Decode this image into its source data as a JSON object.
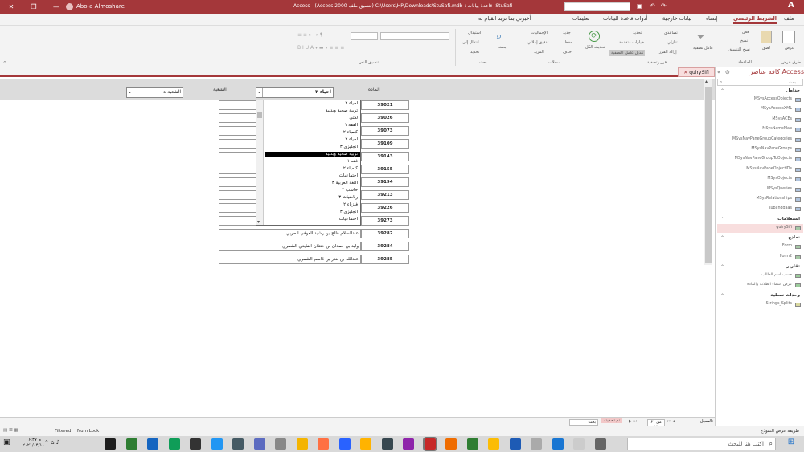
{
  "titlebar": {
    "user": "Abo-a Almoshare",
    "title": "Access  -  (Access 2000 تنسيق ملف) C:\\Users\\HP\\Downloads\\StuSafi.mdb : قاعدة بيانات- StuSafi"
  },
  "ribbon_tabs": [
    "ملف",
    "الشريط الرئيسي",
    "إنشاء",
    "بيانات خارجية",
    "أدوات قاعدة البيانات",
    "تعليمات",
    "أخبرني بما تريد القيام به"
  ],
  "ribbon": {
    "views_btn": "عرض",
    "views_group": "طرق عرض",
    "paste": "لصق",
    "cut": "قص",
    "copy": "نسخ",
    "format_painter": "نسخ التنسيق",
    "clipboard_group": "الحافظة",
    "filter": "عامل تصفية",
    "ascending": "تصاعدي",
    "descending": "تنازلي",
    "remove_sort": "إزالة الفرز",
    "selection": "تحديد",
    "advanced": "خيارات متقدمة",
    "toggle_filter": "تبديل عامل التصفية",
    "sort_filter_group": "فرز وتصفية",
    "refresh_all": "تحديث الكل",
    "new": "جديد",
    "save": "حفظ",
    "delete": "حذف",
    "totals": "الإجماليات",
    "spelling": "تدقيق إملائي",
    "more": "المزيد",
    "records_group": "سجلات",
    "find": "بحث",
    "replace": "استبدال",
    "goto": "انتقال إلى",
    "select": "تحديد",
    "find_group": "بحث",
    "text_format_group": "تنسيق النص"
  },
  "navpane": {
    "header": "كافة عناصر Access",
    "search_placeholder": "بحث...",
    "sections": [
      {
        "title": "جداول",
        "items": [
          "MSysAccessObjects",
          "MSysAccessXML",
          "MSysACEs",
          "MSysNameMap",
          "MSysNavPaneGroupCategories",
          "MSysNavPaneGroups",
          "MSysNavPaneGroupToObjects",
          "MSysNavPaneObjectIDs",
          "MSysObjects",
          "MSysQueries",
          "MSysRelationships",
          "subanddaas"
        ]
      },
      {
        "title": "استعلامات",
        "items": [
          "quirySifi"
        ]
      },
      {
        "title": "نماذج",
        "items": [
          "Form",
          "Form2"
        ]
      },
      {
        "title": "تقارير",
        "items": [
          "حسب اسم الطالب",
          "عرض أسماء الطلاب والمادة"
        ]
      },
      {
        "title": "وحدات نمطية",
        "items": [
          "Strings_Splits"
        ]
      }
    ]
  },
  "doc_tab": "quirySifi",
  "form": {
    "header_subject": "المادة",
    "header_section": "الشعبة",
    "subject_combo_value": "احياء ۲",
    "section_combo_value": "الشعبة ه",
    "records": [
      {
        "id": "39021",
        "name": "جهاد بن عب"
      },
      {
        "id": "39026",
        "name": "تركي بن فهد"
      },
      {
        "id": "39073",
        "name": "سعود بن عبد"
      },
      {
        "id": "39109",
        "name": "عبدالعزيز بن"
      },
      {
        "id": "39143",
        "name": "عبيد بن ناصر"
      },
      {
        "id": "39155",
        "name": "يوسف عادل"
      },
      {
        "id": "39194",
        "name": "مهند بن حسين"
      },
      {
        "id": "39213",
        "name": "محمد بن خالد"
      },
      {
        "id": "39226",
        "name": "محمد بن مريع"
      },
      {
        "id": "39273",
        "name": "حسين علي"
      },
      {
        "id": "39282",
        "name": "عبدالسلام فالح بن رشيد العوفي الحربي"
      },
      {
        "id": "39284",
        "name": "وليد بن حمدان بن خنتلان الفايدي الشمري"
      },
      {
        "id": "39285",
        "name": "عبدالله بن بندر بن قاسم الشمري"
      }
    ]
  },
  "dropdown_items": [
    "احياء ۲",
    "تربية صحية وبدنية",
    "لغتي",
    "الفقه ۱",
    "كيمياء ۲",
    "احياء ۲",
    "انجليزي ۳",
    "تربية صحية وبدنية",
    "فقه ۱",
    "كيمياء ۲",
    "اجتماعيات",
    "اللغة العربية ۳",
    "حاسب ۲",
    "رياضيات ۳",
    "فيزياء ۲",
    "انجليزي ۳",
    "اجتماعيات"
  ],
  "dropdown_selected_index": 7,
  "record_nav": {
    "label": "السجل:",
    "position": "۶۱ من ۱۳",
    "filtered": "تم تصفيته",
    "search": "بحث"
  },
  "statusbar": {
    "view_text": "طريقة عرض النموذج",
    "filtered": "Filtered",
    "numlock": "Num Lock"
  },
  "taskbar": {
    "search_placeholder": "اكتب هنا للبحث",
    "time": "۰۶:۳۷ م",
    "date": "۲۰۲۱/۰۴/۱۰"
  },
  "colors": {
    "accent": "#a4373a",
    "ribbon": "#f3f3f3",
    "header_band": "#dcdcdc"
  }
}
